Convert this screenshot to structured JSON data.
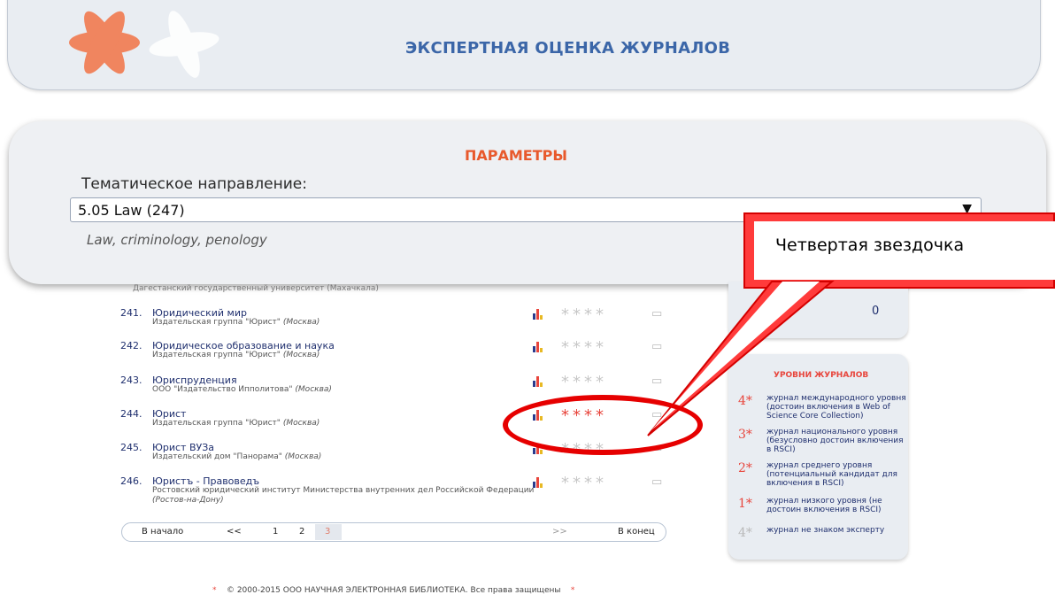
{
  "header": {
    "title": "ЭКСПЕРТНАЯ ОЦЕНКА ЖУРНАЛОВ"
  },
  "params": {
    "title": "ПАРАМЕТРЫ",
    "direction_label": "Тематическое направление:",
    "direction_value": "5.05 Law (247)",
    "direction_desc": "Law, criminology, penology"
  },
  "list": {
    "cut_text": "Дагестанский государственный университет (Махачкала)",
    "rows": [
      {
        "num": "241.",
        "title": "Юридический мир",
        "publisher": "Издательская группа \"Юрист\"",
        "city": "(Москва)"
      },
      {
        "num": "242.",
        "title": "Юридическое образование и наука",
        "publisher": "Издательская группа \"Юрист\"",
        "city": "(Москва)"
      },
      {
        "num": "243.",
        "title": "Юриспруденция",
        "publisher": "ООО \"Издательство Ипполитова\"",
        "city": "(Москва)"
      },
      {
        "num": "244.",
        "title": "Юрист",
        "publisher": "Издательская группа \"Юрист\"",
        "city": "(Москва)"
      },
      {
        "num": "245.",
        "title": "Юрист ВУЗа",
        "publisher": "Издательский дом \"Панорама\"",
        "city": "(Москва)"
      },
      {
        "num": "246.",
        "title": "Юристъ - Правоведъ",
        "publisher": "Ростовский юридический институт Министерства внутренних дел Российской Федерации",
        "city": "(Ростов-на-Дону)"
      }
    ],
    "stars": "****",
    "stars_red_row": 3
  },
  "pager": {
    "first": "В начало",
    "prev": "<<",
    "p1": "1",
    "p2": "2",
    "p3": "3",
    "next": ">>",
    "last": "В конец"
  },
  "right_box": {
    "count": "0"
  },
  "levels": {
    "title": "УРОВНИ ЖУРНАЛОВ",
    "items": [
      {
        "sym": "4*",
        "text": "журнал международного уровня (достоин включения в Web of Science Core Collection)",
        "color": "#e8453c"
      },
      {
        "sym": "3*",
        "text": "журнал национального уровня (безусловно достоин включения в RSCI)",
        "color": "#e8453c"
      },
      {
        "sym": "2*",
        "text": "журнал среднего уровня (потенциальный кандидат для включения в RSCI)",
        "color": "#e8453c"
      },
      {
        "sym": "1*",
        "text": "журнал низкого уровня (не достоин включения в RSCI)",
        "color": "#e8453c"
      },
      {
        "sym": "4*",
        "text": "журнал не знаком эксперту",
        "color": "#b9b9b9"
      }
    ]
  },
  "footer": {
    "text": "© 2000-2015 ООО НАУЧНАЯ ЭЛЕКТРОННАЯ БИБЛИОТЕКА. Все права защищены"
  },
  "callout": {
    "text": "Четвертая звездочка"
  },
  "colors": {
    "accent": "#e8453c",
    "link": "#1f2f6e",
    "header_title": "#3b66a8"
  }
}
